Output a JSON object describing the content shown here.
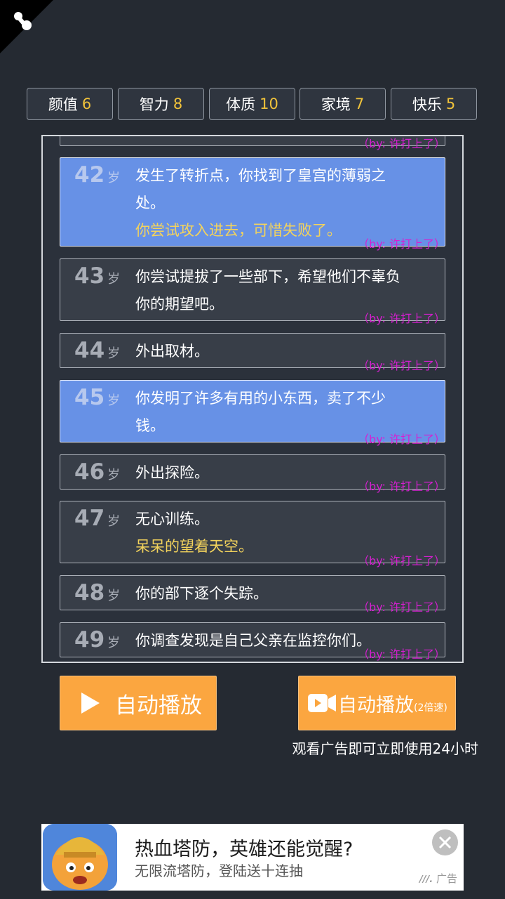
{
  "stats": [
    {
      "label": "颜值",
      "value": "6"
    },
    {
      "label": "智力",
      "value": "8"
    },
    {
      "label": "体质",
      "value": "10"
    },
    {
      "label": "家境",
      "value": "7"
    },
    {
      "label": "快乐",
      "value": "5"
    }
  ],
  "age_unit": "岁",
  "watermark": "（by: 许打上了）",
  "events": [
    {
      "age": "42",
      "line1": "发生了转折点，你找到了皇宫的薄弱之",
      "line2": "处。",
      "line3": "你尝试攻入进去，可惜失败了。"
    },
    {
      "age": "43",
      "line1": "你尝试提拔了一些部下，希望他们不辜负",
      "line2": "你的期望吧。"
    },
    {
      "age": "44",
      "line1": "外出取材。"
    },
    {
      "age": "45",
      "line1": "你发明了许多有用的小东西，卖了不少",
      "line2": "钱。"
    },
    {
      "age": "46",
      "line1": "外出探险。"
    },
    {
      "age": "47",
      "line1": "无心训练。",
      "line2": "呆呆的望着天空。"
    },
    {
      "age": "48",
      "line1": "你的部下逐个失踪。"
    },
    {
      "age": "49",
      "line1": "你调查发现是自己父亲在监控你们。"
    }
  ],
  "buttons": {
    "auto_play": "自动播放",
    "auto_play_fast": "自动播放",
    "fast_suffix": "(2倍速)",
    "hint": "观看广告即可立即使用24小时"
  },
  "ad": {
    "title": "热血塔防，英雄还能觉醒?",
    "subtitle": "无限流塔防，登陆送十连抽",
    "tag": "广告"
  },
  "colors": {
    "highlight": "#6791e6",
    "accent": "#f0c23a",
    "button": "#fba640",
    "watermark": "#d61fd1"
  }
}
